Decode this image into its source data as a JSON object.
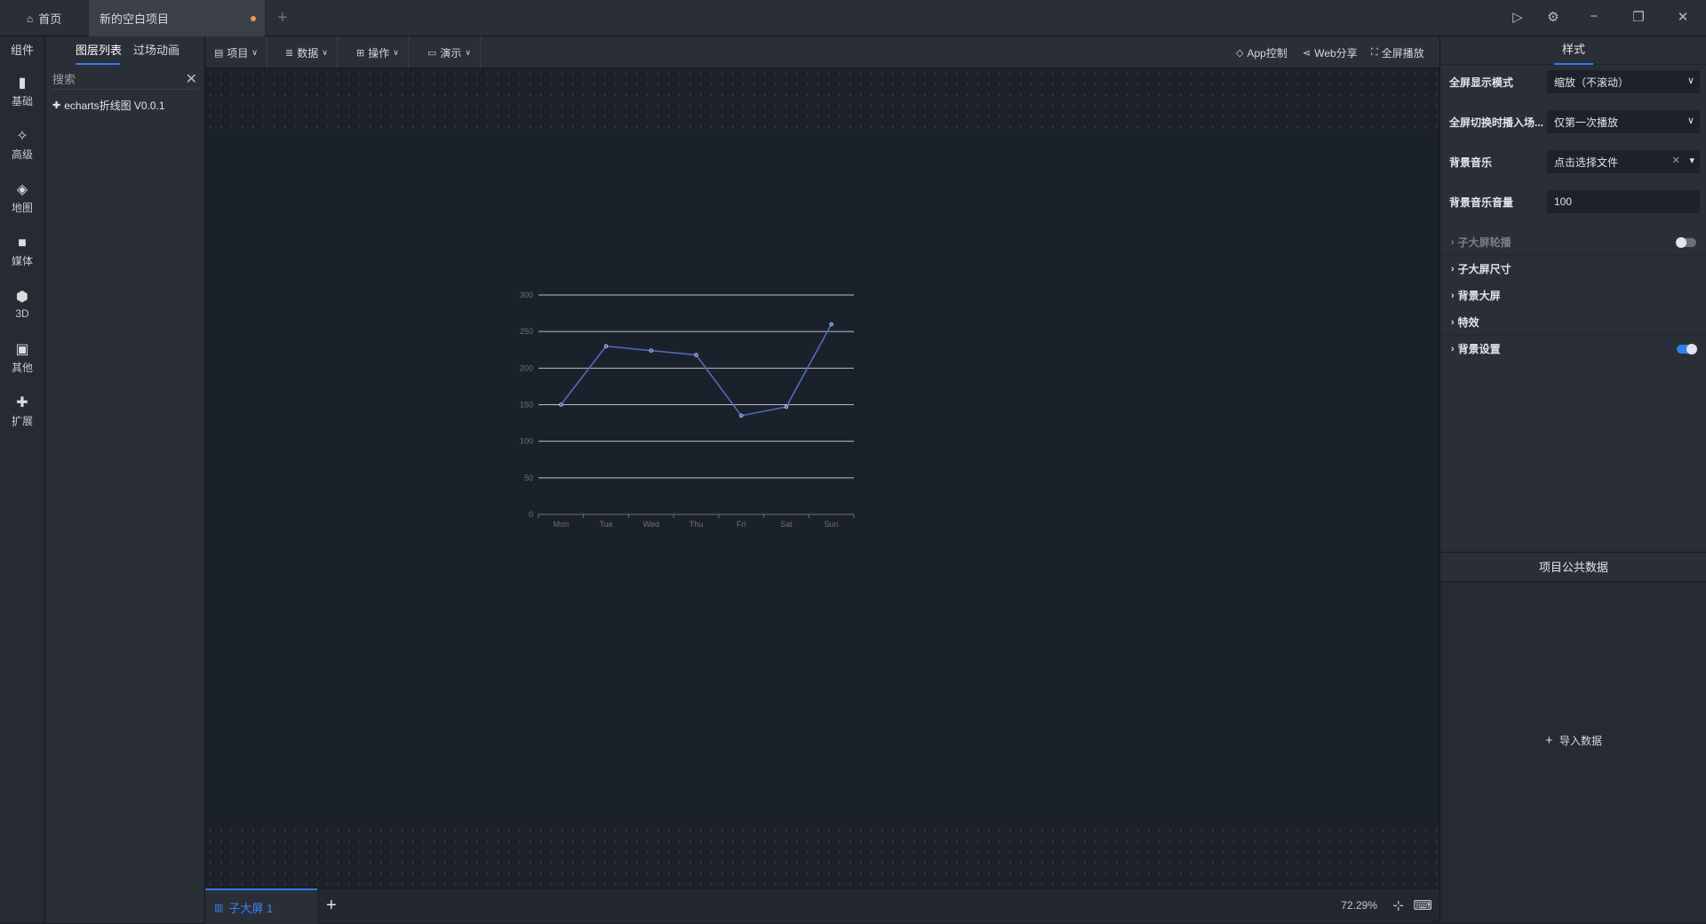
{
  "topbar": {
    "home_tab": "首页",
    "project_tab": "新的空白项目",
    "add_tab": "+"
  },
  "leftrail": {
    "header": "组件",
    "items": [
      {
        "label": "基础",
        "icon": "bar-chart-icon"
      },
      {
        "label": "高级",
        "icon": "advanced-icon"
      },
      {
        "label": "地图",
        "icon": "map-icon"
      },
      {
        "label": "媒体",
        "icon": "camera-icon"
      },
      {
        "label": "3D",
        "icon": "cube-icon"
      },
      {
        "label": "其他",
        "icon": "image-icon"
      },
      {
        "label": "扩展",
        "icon": "puzzle-icon"
      }
    ]
  },
  "layerpanel": {
    "tab_layers": "图层列表",
    "tab_transitions": "过场动画",
    "search_placeholder": "搜索",
    "layers": [
      {
        "label": "echarts折线图 V0.0.1"
      }
    ]
  },
  "toolbar": {
    "menus": [
      "项目",
      "数据",
      "操作",
      "演示"
    ],
    "app_control": "App控制",
    "web_share": "Web分享",
    "fullscreen_play": "全屏播放"
  },
  "chart_data": {
    "type": "line",
    "categories": [
      "Mon",
      "Tue",
      "Wed",
      "Thu",
      "Fri",
      "Sat",
      "Sun"
    ],
    "values": [
      150,
      230,
      224,
      218,
      135,
      147,
      260
    ],
    "yticks": [
      "0",
      "50",
      "100",
      "150",
      "200",
      "250",
      "300"
    ],
    "ylim": [
      0,
      300
    ],
    "grid": true,
    "line_color": "#5470c6"
  },
  "bottombar": {
    "sub_screen_tab": "子大屏 1",
    "add": "+",
    "zoom": "72.29%"
  },
  "rightpanel": {
    "tab": "样式",
    "props": [
      {
        "label": "全屏显示模式",
        "value": "缩放（不滚动）"
      },
      {
        "label": "全屏切换时播入场...",
        "value": "仅第一次播放"
      },
      {
        "label": "背景音乐",
        "value": "点击选择文件"
      },
      {
        "label": "背景音乐音量",
        "value": "100"
      }
    ],
    "sections": [
      {
        "label": "子大屏轮播",
        "toggle": "off",
        "disabled": true
      },
      {
        "label": "子大屏尺寸"
      },
      {
        "label": "背景大屏"
      },
      {
        "label": "特效"
      },
      {
        "label": "背景设置",
        "toggle": "on"
      }
    ],
    "public_data_title": "项目公共数据",
    "import_data": "导入数据"
  },
  "colors": {
    "accent": "#2f7ef5",
    "modified_dot": "#e0a24a"
  }
}
